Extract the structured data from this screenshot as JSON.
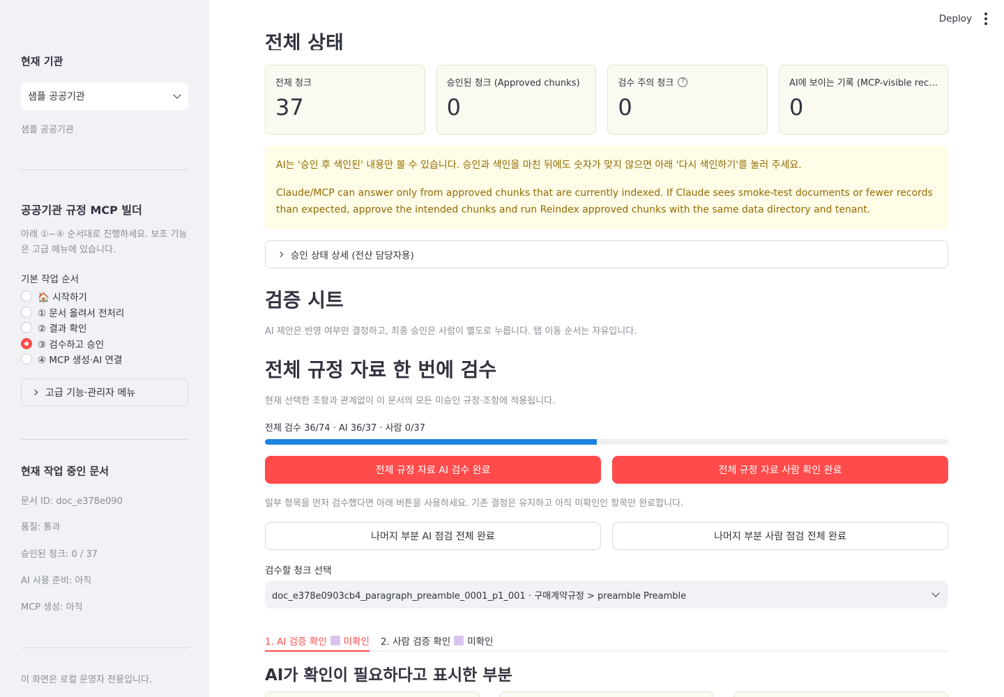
{
  "sidebar": {
    "current_org_label": "현재 기관",
    "org_select_value": "샘플 공공기관",
    "org_caption": "샘플 공공기관",
    "builder_title": "공공기관 규정 MCP 빌더",
    "builder_desc": "아래 ①~④ 순서대로 진행하세요. 보조 기능은 고급 메뉴에 있습니다.",
    "workflow_label": "기본 작업 순서",
    "workflow_steps": [
      {
        "label": "🏠 시작하기",
        "selected": false
      },
      {
        "label": "① 문서 올려서 전처리",
        "selected": false
      },
      {
        "label": "② 결과 확인",
        "selected": false
      },
      {
        "label": "③ 검수하고 승인",
        "selected": true
      },
      {
        "label": "④ MCP 생성·AI 연결",
        "selected": false
      }
    ],
    "advanced_label": "고급 기능·관리자 메뉴",
    "current_doc_title": "현재 작업 중인 문서",
    "doc_id": "문서 ID: doc_e378e090",
    "quality": "품질: 통과",
    "approved_chunks": "승인된 청크: 0 / 37",
    "ai_ready": "AI 사용 준비: 아직",
    "mcp_created": "MCP 생성: 아직",
    "footer_note": "이 화면은 로컬 운영자 전용입니다."
  },
  "topbar": {
    "deploy_label": "Deploy"
  },
  "main": {
    "cut_title": "전체 상태",
    "metrics": [
      {
        "label": "전체 청크",
        "value": "37",
        "help": false
      },
      {
        "label": "승인된 청크 (Approved chunks)",
        "value": "0",
        "help": false
      },
      {
        "label": "검수 주의 청크",
        "value": "0",
        "help": true
      },
      {
        "label": "AI에 보이는 기록 (MCP-visible rec…",
        "value": "0",
        "help": false
      }
    ],
    "alert_ko": "AI는 '승인 후 색인된' 내용만 볼 수 있습니다. 승인과 색인을 마친 뒤에도 숫자가 맞지 않으면 아래 '다시 색인하기'를 눌러 주세요.",
    "alert_en": "Claude/MCP can answer only from approved chunks that are currently indexed. If Claude sees smoke-test documents or fewer records than expected, approve the intended chunks and run Reindex approved chunks with the same data directory and tenant.",
    "approval_expander": "승인 상태 상세 (전산 담당자용)",
    "verify_title": "검증 시트",
    "verify_caption": "AI 제안은 반영 여부만 결정하고, 최종 승인은 사람이 별도로 누릅니다. 탭 이동 순서는 자유입니다.",
    "bulk_title": "전체 규정 자료 한 번에 검수",
    "bulk_caption": "현재 선택한 조항과 관계없이 이 문서의 모든 미승인 규정·조항에 적용됩니다.",
    "progress_label": "전체 검수 36/74 · AI 36/37 · 사람 0/37",
    "progress_value": 0.486,
    "btn_ai_complete": "전체 규정 자료 AI 검수 완료",
    "btn_human_complete": "전체 규정 자료 사람 확인 완료",
    "partial_caption": "일부 항목을 먼저 검수했다면 아래 버튼을 사용하세요. 기존 결정은 유지하고 아직 미확인인 항목만 완료합니다.",
    "btn_rest_ai": "나머지 부분 AI 점검 전체 완료",
    "btn_rest_human": "나머지 부분 사람 점검 전체 완료",
    "chunk_select_label": "검수할 청크 선택",
    "chunk_select_value": "doc_e378e0903cb4_paragraph_preamble_0001_p1_001 · 구매계약규정 > preamble Preamble",
    "tabs": [
      {
        "label": "1. AI 검증 확인",
        "status": "미확인"
      },
      {
        "label": "2. 사람 검증 확인",
        "status": "미확인"
      }
    ],
    "ai_flag_title": "AI가 확인이 필요하다고 표시한 부분"
  },
  "colors": {
    "accent": "#ff4b4b",
    "progress": "#1c83e1",
    "alert_text": "#926c05",
    "alert_bg": "#fffce7"
  }
}
